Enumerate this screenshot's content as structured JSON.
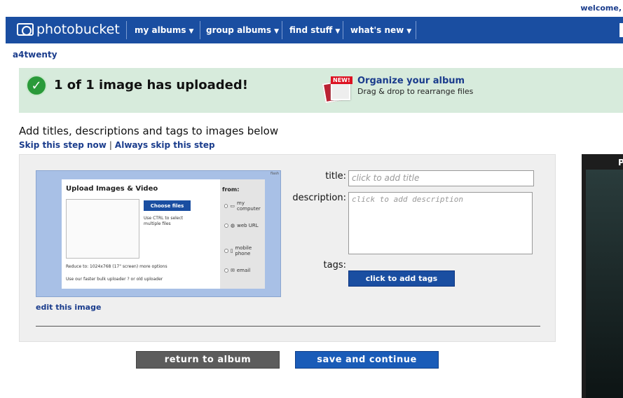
{
  "header": {
    "welcome": "welcome,",
    "logo": "photobucket",
    "nav": [
      {
        "label": "my albums"
      },
      {
        "label": "group albums"
      },
      {
        "label": "find stuff"
      },
      {
        "label": "what's new"
      }
    ]
  },
  "user": {
    "name": "a4twenty"
  },
  "success": {
    "message": "1 of 1 image has uploaded!",
    "promo_badge": "NEW!",
    "promo_title": "Organize your album",
    "promo_subtitle": "Drag & drop to rearrange files"
  },
  "page": {
    "heading": "Add titles, descriptions and tags to images below",
    "skip_step": "Skip this step now",
    "skip_separator": "|",
    "always_skip": "Always skip this step"
  },
  "thumbnail": {
    "title": "Upload Images & Video",
    "from": "from:",
    "choose_files": "Choose files",
    "hint": "Use CTRL to select multiple files",
    "options": [
      "my computer",
      "web URL",
      "mobile phone",
      "email"
    ],
    "reduce": "Reduce to: 1024x768 (17\" screen)  more options",
    "bulk": "Use our faster bulk uploader ? or old uploader",
    "corner": "flash"
  },
  "edit_link": "edit this image",
  "form": {
    "title_label": "title:",
    "title_placeholder": "click to add title",
    "description_label": "description:",
    "description_placeholder": "click to add description",
    "tags_label": "tags:",
    "tags_button": "click to add tags"
  },
  "actions": {
    "return": "return to album",
    "save": "save and continue"
  },
  "sidebar": {
    "letter": "P"
  },
  "colors": {
    "nav_bg": "#1a4ea1",
    "link": "#1a3c8c",
    "success_bg": "#d7ebdc",
    "check": "#2a9a3a",
    "save_btn": "#1a5cb8",
    "return_btn": "#5c5c5c"
  }
}
